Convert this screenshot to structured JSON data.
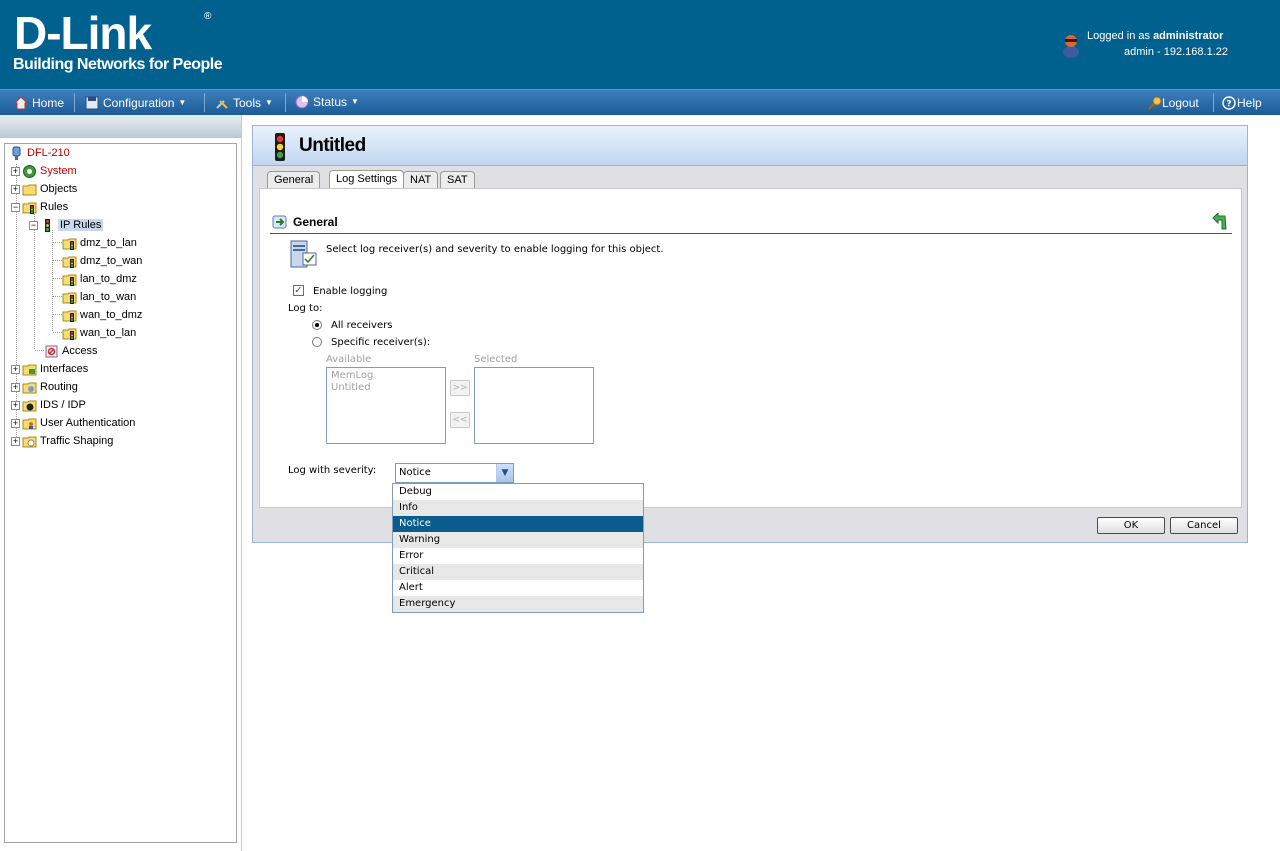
{
  "header": {
    "logo_main": "D-Link",
    "logo_reg": "®",
    "logo_tagline": "Building Networks for People",
    "login_prefix": "Logged in as",
    "login_user": "administrator",
    "login_detail": "admin - 192.168.1.22"
  },
  "menu": {
    "home": "Home",
    "configuration": "Configuration",
    "tools": "Tools",
    "status": "Status",
    "logout": "Logout",
    "help": "Help"
  },
  "tree": {
    "root": "DFL-210",
    "system": "System",
    "objects": "Objects",
    "rules": "Rules",
    "ip_rules": "IP Rules",
    "rules_children": [
      "dmz_to_lan",
      "dmz_to_wan",
      "lan_to_dmz",
      "lan_to_wan",
      "wan_to_dmz",
      "wan_to_lan"
    ],
    "access": "Access",
    "interfaces": "Interfaces",
    "routing": "Routing",
    "ids_idp": "IDS / IDP",
    "user_auth": "User Authentication",
    "traffic_shaping": "Traffic Shaping"
  },
  "panel": {
    "title": "Untitled",
    "tabs": [
      "General",
      "Log Settings",
      "NAT",
      "SAT"
    ],
    "active_tab": "Log Settings",
    "section_title": "General",
    "intro": "Select log receiver(s) and severity to enable logging for this object.",
    "enable_logging": "Enable logging",
    "log_to": "Log to:",
    "all_receivers": "All receivers",
    "specific_receivers": "Specific receiver(s):",
    "available_label": "Available",
    "selected_label": "Selected",
    "available_items": [
      "MemLog",
      "Untitled"
    ],
    "add_btn": ">>",
    "remove_btn": "<<",
    "severity_label": "Log with severity:",
    "severity_value": "Notice",
    "severity_options": [
      "Debug",
      "Info",
      "Notice",
      "Warning",
      "Error",
      "Critical",
      "Alert",
      "Emergency"
    ],
    "ok": "OK",
    "cancel": "Cancel"
  },
  "colors": {
    "header_bg": "#00618f",
    "highlight": "#0a5c8c",
    "tree_red": "#c00000"
  }
}
